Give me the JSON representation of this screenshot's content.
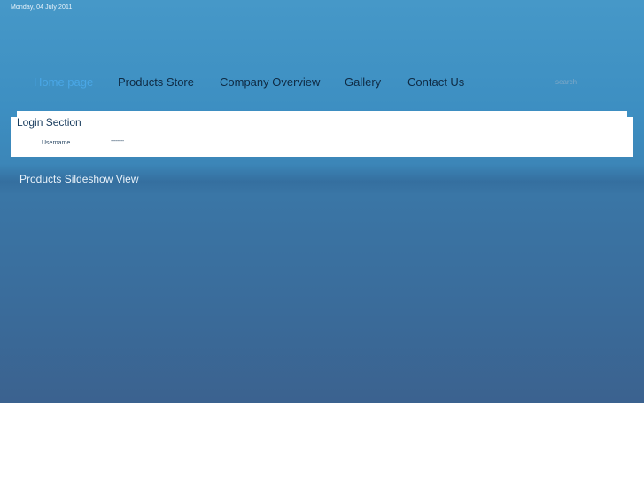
{
  "header": {
    "date": "Monday, 04 July 2011"
  },
  "nav": {
    "items": [
      {
        "label": "Home page"
      },
      {
        "label": "Products Store"
      },
      {
        "label": "Company Overview"
      },
      {
        "label": "Gallery"
      },
      {
        "label": "Contact Us"
      }
    ]
  },
  "search": {
    "placeholder": "search"
  },
  "login": {
    "title": "Login Section",
    "username_label": "Username",
    "password_value": "--------"
  },
  "slideshow": {
    "title": "Products Sildeshow View"
  }
}
